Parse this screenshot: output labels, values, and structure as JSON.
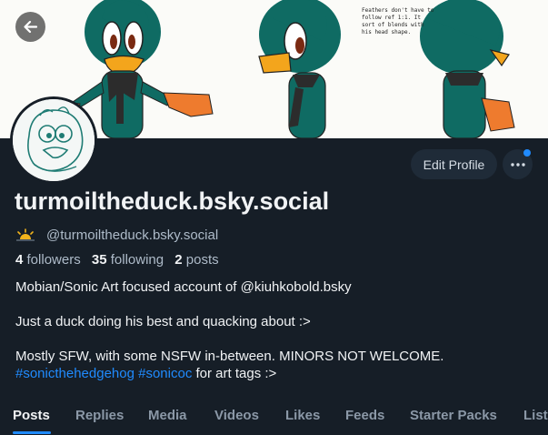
{
  "banner": {
    "note": "Feathers don't have to follow ref 1:1. It sort of blends with his head shape."
  },
  "profile": {
    "display_name": "turmoiltheduck.bsky.social",
    "handle": "@turmoiltheduck.bsky.social",
    "followers_count": "4",
    "followers_label": "followers",
    "following_count": "35",
    "following_label": "following",
    "posts_count": "2",
    "posts_label": "posts"
  },
  "actions": {
    "edit_profile_label": "Edit Profile",
    "more_icon": "ellipsis-icon",
    "back_icon": "arrow-left-icon"
  },
  "bio": {
    "line1": "Mobian/Sonic Art focused account of @kiuhkobold.bsky",
    "line2": "Just a duck doing his best and quacking about :>",
    "line3": "Mostly SFW, with some NSFW in-between. MINORS NOT WELCOME.",
    "tag1": "#sonicthehedgehog",
    "tag2": "#sonicoc",
    "line4_suffix": "for art tags :>"
  },
  "tabs": [
    {
      "label": "Posts"
    },
    {
      "label": "Replies"
    },
    {
      "label": "Media"
    },
    {
      "label": "Videos"
    },
    {
      "label": "Likes"
    },
    {
      "label": "Feeds"
    },
    {
      "label": "Starter Packs"
    },
    {
      "label": "Lists"
    }
  ],
  "colors": {
    "background": "#161e27",
    "accent": "#208bfe",
    "muted_text": "#aebbc9",
    "button_bg": "#1f2b38"
  }
}
